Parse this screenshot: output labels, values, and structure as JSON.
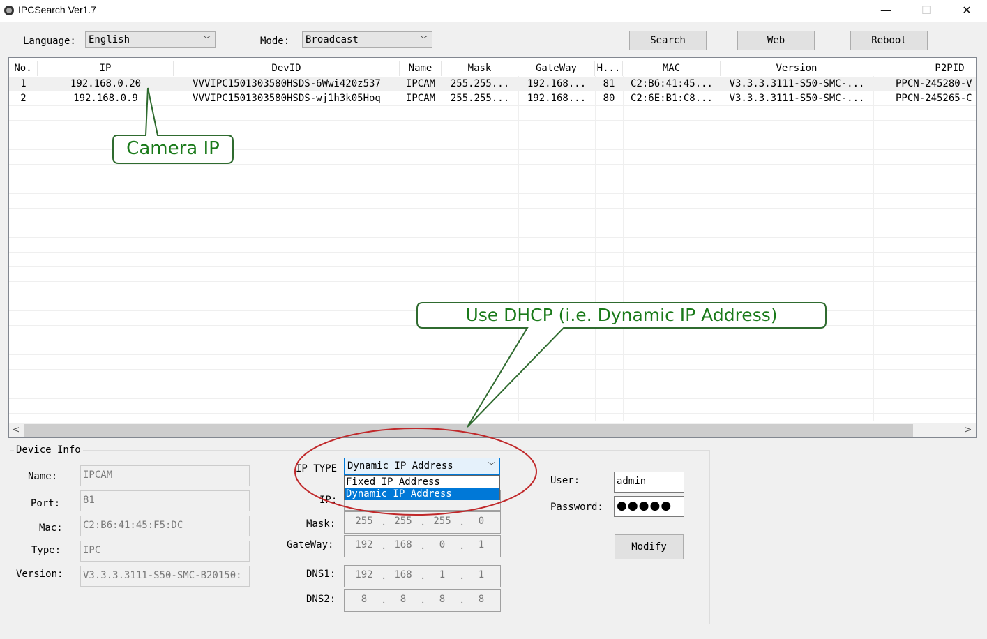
{
  "window": {
    "title": "IPCSearch Ver1.7",
    "minimize": "—",
    "maximize": "☐",
    "close": "✕"
  },
  "toolbar": {
    "language_label": "Language:",
    "language_value": "English",
    "mode_label": "Mode:",
    "mode_value": "Broadcast",
    "search_label": "Search",
    "web_label": "Web",
    "reboot_label": "Reboot"
  },
  "table": {
    "columns": [
      "No.",
      "IP",
      "DevID",
      "Name",
      "Mask",
      "GateWay",
      "H...",
      "MAC",
      "Version",
      "P2PID"
    ],
    "rows": [
      [
        "1",
        "192.168.0.20",
        "VVVIPC1501303580HSDS-6Wwi420z537",
        "IPCAM",
        "255.255...",
        "192.168...",
        "81",
        "C2:B6:41:45...",
        "V3.3.3.3111-S50-SMC-...",
        "PPCN-245280-V"
      ],
      [
        "2",
        "192.168.0.9",
        "VVVIPC1501303580HSDS-wj1h3k05Hoq",
        "IPCAM",
        "255.255...",
        "192.168...",
        "80",
        "C2:6E:B1:C8...",
        "V3.3.3.3111-S50-SMC-...",
        "PPCN-245265-C"
      ]
    ],
    "scroll_left": "<",
    "scroll_right": ">"
  },
  "device_info": {
    "group_title": "Device Info",
    "name_label": "Name:",
    "name_value": "IPCAM",
    "port_label": "Port:",
    "port_value": "81",
    "mac_label": "Mac:",
    "mac_value": "C2:B6:41:45:F5:DC",
    "type_label": "Type:",
    "type_value": "IPC",
    "version_label": "Version:",
    "version_value": "V3.3.3.3111-S50-SMC-B20150:",
    "iptype_label": "IP TYPE",
    "iptype_value": "Dynamic IP Address",
    "iptype_options": [
      "Fixed IP Address",
      "Dynamic IP Address"
    ],
    "ip_label": "IP:",
    "mask_label": "Mask:",
    "mask": [
      "255",
      "255",
      "255",
      "0"
    ],
    "gateway_label": "GateWay:",
    "gateway": [
      "192",
      "168",
      "0",
      "1"
    ],
    "dns1_label": "DNS1:",
    "dns1": [
      "192",
      "168",
      "1",
      "1"
    ],
    "dns2_label": "DNS2:",
    "dns2": [
      "8",
      "8",
      "8",
      "8"
    ],
    "user_label": "User:",
    "user_value": "admin",
    "password_label": "Password:",
    "password_mask": "●●●●●",
    "modify_label": "Modify"
  },
  "annotations": {
    "camera_ip": "Camera IP",
    "dhcp": "Use DHCP (i.e. Dynamic IP Address)",
    "text_color": "#1a7a1a",
    "highlight_color": "#c0282a"
  }
}
